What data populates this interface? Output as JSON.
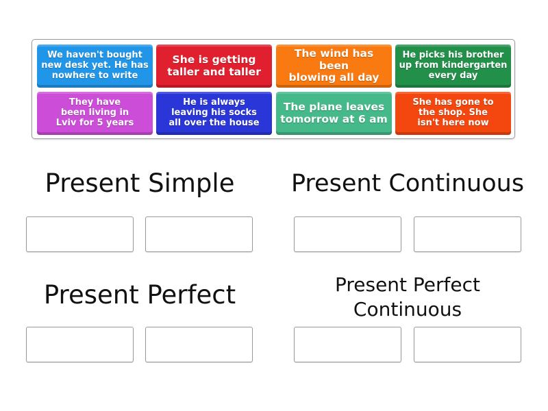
{
  "cards": [
    {
      "text": "We haven't bought\nnew desk yet. He has\nnowhere to write",
      "color": "#2196e8"
    },
    {
      "text": "She is getting\ntaller and taller",
      "color": "#e0202e"
    },
    {
      "text": "The wind has been\nblowing all day",
      "color": "#f97a10"
    },
    {
      "text": "He picks his brother\nup from kindergarten\nevery day",
      "color": "#23904a"
    },
    {
      "text": "They have\nbeen living in\nLviv for 5 years",
      "color": "#cc4ed8"
    },
    {
      "text": "He is always\nleaving his socks\nall over the house",
      "color": "#2a36d8"
    },
    {
      "text": "The plane leaves\ntomorrow at 6 am",
      "color": "#45b98a"
    },
    {
      "text": "She has gone to\nthe shop. She\nisn't here now",
      "color": "#f3470f"
    }
  ],
  "categories": [
    {
      "title": "Present Simple"
    },
    {
      "title": "Present Continuous"
    },
    {
      "title": "Present Perfect"
    },
    {
      "title": "Present Perfect\nContinuous"
    }
  ]
}
